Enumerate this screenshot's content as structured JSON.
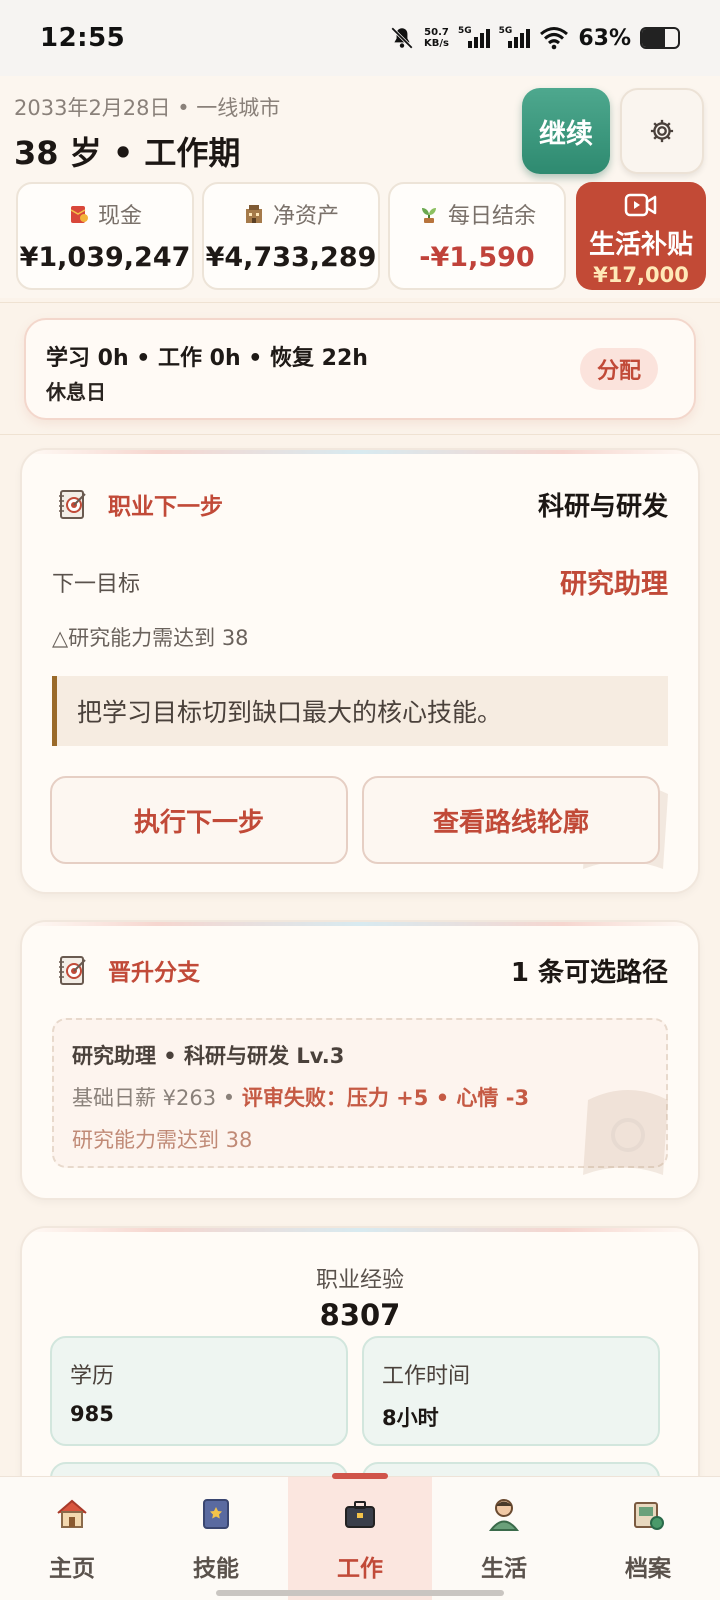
{
  "status_bar": {
    "time": "12:55",
    "speed_value": "50.7",
    "speed_unit": "KB/s",
    "network_1": "5G",
    "network_2": "5G",
    "battery_percent": "63%",
    "battery_level": 0.63
  },
  "header": {
    "date_city": "2033年2月28日 • 一线城市",
    "age_stage": "38 岁 • 工作期",
    "continue_label": "继续",
    "settings_icon": "gear-icon"
  },
  "stats": {
    "cash": {
      "label": "现金",
      "value": "¥1,039,247",
      "icon": "red-envelope-icon"
    },
    "net_assets": {
      "label": "净资产",
      "value": "¥4,733,289",
      "icon": "building-icon"
    },
    "daily_balance": {
      "label": "每日结余",
      "value": "-¥1,590",
      "icon": "sprout-icon"
    }
  },
  "subsidy": {
    "title": "生活补贴",
    "amount": "¥17,000",
    "icon": "video-camera-icon"
  },
  "allocation": {
    "summary": "学习 0h • 工作 0h • 恢复 22h",
    "day_type": "休息日",
    "allocate_label": "分配"
  },
  "next_step_card": {
    "title": "职业下一步",
    "field": "科研与研发",
    "next_goal_label": "下一目标",
    "next_goal_value": "研究助理",
    "requirement": "△研究能力需达到 38",
    "tip": "把学习目标切到缺口最大的核心技能。",
    "execute_label": "执行下一步",
    "view_route_label": "查看路线轮廓"
  },
  "branch_card": {
    "title": "晋升分支",
    "paths_count": "1 条可选路径",
    "path_title": "研究助理 • 科研与研发 Lv.3",
    "base_salary": "基础日薪 ¥263 • ",
    "review_fail": "评审失败：压力 +5 • 心情 -3",
    "requirement": "研究能力需达到 38"
  },
  "experience_card": {
    "label": "职业经验",
    "value": "8307",
    "education_label": "学历",
    "education_value": "985",
    "work_hours_label": "工作时间",
    "work_hours_value": "8小时"
  },
  "bottom_nav": {
    "items": [
      {
        "label": "主页",
        "icon": "house-icon"
      },
      {
        "label": "技能",
        "icon": "book-icon"
      },
      {
        "label": "工作",
        "icon": "briefcase-icon"
      },
      {
        "label": "生活",
        "icon": "person-icon"
      },
      {
        "label": "档案",
        "icon": "archive-icon"
      }
    ],
    "active_index": 2
  },
  "colors": {
    "accent_red": "#c14a38",
    "continue_green": "#2e8a70",
    "subsidy_red": "#c24a36",
    "tile_green": "#eef5f1"
  }
}
